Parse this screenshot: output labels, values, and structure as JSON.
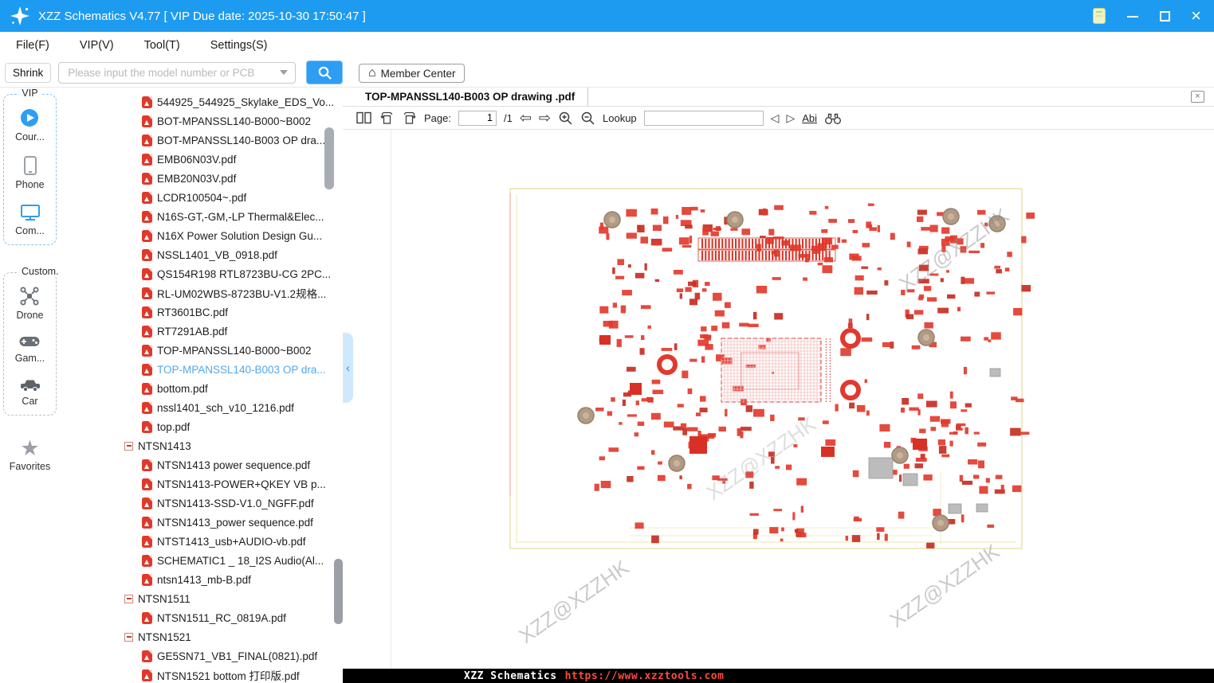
{
  "titlebar": {
    "title": "XZZ Schematics V4.77 [ VIP Due date: 2025-10-30 17:50:47 ]"
  },
  "menu": {
    "items": [
      "File(F)",
      "VIP(V)",
      "Tool(T)",
      "Settings(S)"
    ]
  },
  "toolbar": {
    "shrink": "Shrink",
    "search_placeholder": "Please input the model number or PCB",
    "member_center": "Member Center"
  },
  "sidebar": {
    "vip_label": "VIP",
    "vip_items": [
      {
        "icon": "play-circle-icon",
        "label": "Cour..."
      },
      {
        "icon": "phone-icon",
        "label": "Phone"
      },
      {
        "icon": "computer-icon",
        "label": "Com..."
      }
    ],
    "custom_label": "Custom.",
    "custom_items": [
      {
        "icon": "drone-icon",
        "label": "Drone"
      },
      {
        "icon": "gamepad-icon",
        "label": "Gam..."
      },
      {
        "icon": "car-icon",
        "label": "Car"
      }
    ],
    "favorites_label": "Favorites"
  },
  "tree": {
    "items": [
      {
        "kind": "file",
        "label": "544925_544925_Skylake_EDS_Vo..."
      },
      {
        "kind": "file",
        "label": "BOT-MPANSSL140-B000~B002"
      },
      {
        "kind": "file",
        "label": "BOT-MPANSSL140-B003 OP dra..."
      },
      {
        "kind": "file",
        "label": "EMB06N03V.pdf"
      },
      {
        "kind": "file",
        "label": "EMB20N03V.pdf"
      },
      {
        "kind": "file",
        "label": "LCDR100504~.pdf"
      },
      {
        "kind": "file",
        "label": "N16S-GT,-GM,-LP Thermal&Elec..."
      },
      {
        "kind": "file",
        "label": "N16X Power Solution Design Gu..."
      },
      {
        "kind": "file",
        "label": "NSSL1401_VB_0918.pdf"
      },
      {
        "kind": "file",
        "label": "QS154R198 RTL8723BU-CG 2PC..."
      },
      {
        "kind": "file",
        "label": "RL-UM02WBS-8723BU-V1.2规格..."
      },
      {
        "kind": "file",
        "label": "RT3601BC.pdf"
      },
      {
        "kind": "file",
        "label": "RT7291AB.pdf"
      },
      {
        "kind": "file",
        "label": "TOP-MPANSSL140-B000~B002"
      },
      {
        "kind": "file",
        "label": "TOP-MPANSSL140-B003 OP dra...",
        "selected": true
      },
      {
        "kind": "file",
        "label": "bottom.pdf"
      },
      {
        "kind": "file",
        "label": "nssl1401_sch_v10_1216.pdf"
      },
      {
        "kind": "file",
        "label": "top.pdf"
      },
      {
        "kind": "node",
        "label": "NTSN1413"
      },
      {
        "kind": "file",
        "label": "NTSN1413 power sequence.pdf"
      },
      {
        "kind": "file",
        "label": "NTSN1413-POWER+QKEY VB p..."
      },
      {
        "kind": "file",
        "label": "NTSN1413-SSD-V1.0_NGFF.pdf"
      },
      {
        "kind": "file",
        "label": "NTSN1413_power sequence.pdf"
      },
      {
        "kind": "file",
        "label": "NTST1413_usb+AUDIO-vb.pdf"
      },
      {
        "kind": "file",
        "label": "SCHEMATIC1 _ 18_I2S Audio(Al..."
      },
      {
        "kind": "file",
        "label": "ntsn1413_mb-B.pdf"
      },
      {
        "kind": "node",
        "label": "NTSN1511"
      },
      {
        "kind": "file",
        "label": "NTSN1511_RC_0819A.pdf"
      },
      {
        "kind": "node",
        "label": "NTSN1521"
      },
      {
        "kind": "file",
        "label": "GE5SN71_VB1_FINAL(0821).pdf"
      },
      {
        "kind": "file",
        "label": "NTSN1521 bottom 打印版.pdf"
      }
    ]
  },
  "viewer": {
    "tab_title": "TOP-MPANSSL140-B003 OP drawing .pdf",
    "pdf_toolbar": {
      "page_label": "Page:",
      "page_value": "1",
      "page_total": "/1",
      "lookup_label": "Lookup",
      "lookup_value": "",
      "font_tool": "Abi"
    },
    "watermark": "XZZ@XZZHK",
    "statusbar": {
      "app": "XZZ Schematics",
      "url": "https://www.xzztools.com"
    }
  },
  "colors": {
    "accent_blue": "#1d9bf0",
    "pdf_red": "#e0392b",
    "selected_file": "#53a7e9",
    "status_url_red": "#ff4a3d"
  }
}
